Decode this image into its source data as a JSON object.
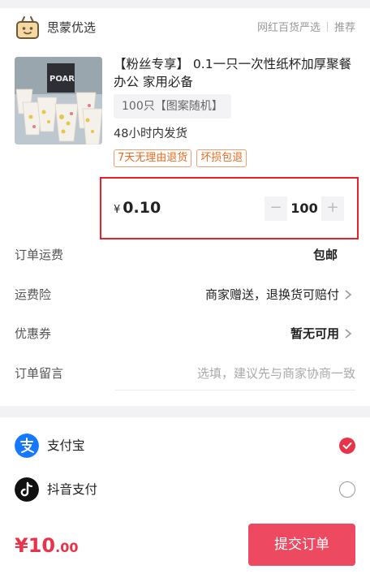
{
  "store": {
    "name": "思蒙优选",
    "tag1": "网红百货严选",
    "tag2": "推荐"
  },
  "product": {
    "title": "【粉丝专享】 0.1一只一次性纸杯加厚聚餐 办公 家用必备",
    "variant": "100只【图案随机】",
    "shipping": "48小时内发货",
    "badges": [
      "7天无理由退货",
      "坏损包退"
    ],
    "price_symbol": "¥",
    "price": "0.10",
    "qty_minus": "−",
    "quantity": "100",
    "qty_plus": "+",
    "image_text": "POAR"
  },
  "order_rows": {
    "freight_label": "订单运费",
    "freight_value": "包邮",
    "insurance_label": "运费险",
    "insurance_value": "商家赠送，退换货可赔付",
    "coupon_label": "优惠券",
    "coupon_value": "暂无可用",
    "note_label": "订单留言",
    "note_placeholder": "选填，建议先与商家协商一致"
  },
  "payment": {
    "options": [
      {
        "label": "支付宝",
        "icon": "alipay-icon",
        "selected": true
      },
      {
        "label": "抖音支付",
        "icon": "douyin-icon",
        "selected": false
      }
    ]
  },
  "footer": {
    "total_symbol": "¥",
    "total_main": "10",
    "total_decimal": ".00",
    "submit_label": "提交订单"
  },
  "colors": {
    "accent": "#e8344a",
    "badge": "#e86a20",
    "highlight_box": "#e8212a"
  }
}
